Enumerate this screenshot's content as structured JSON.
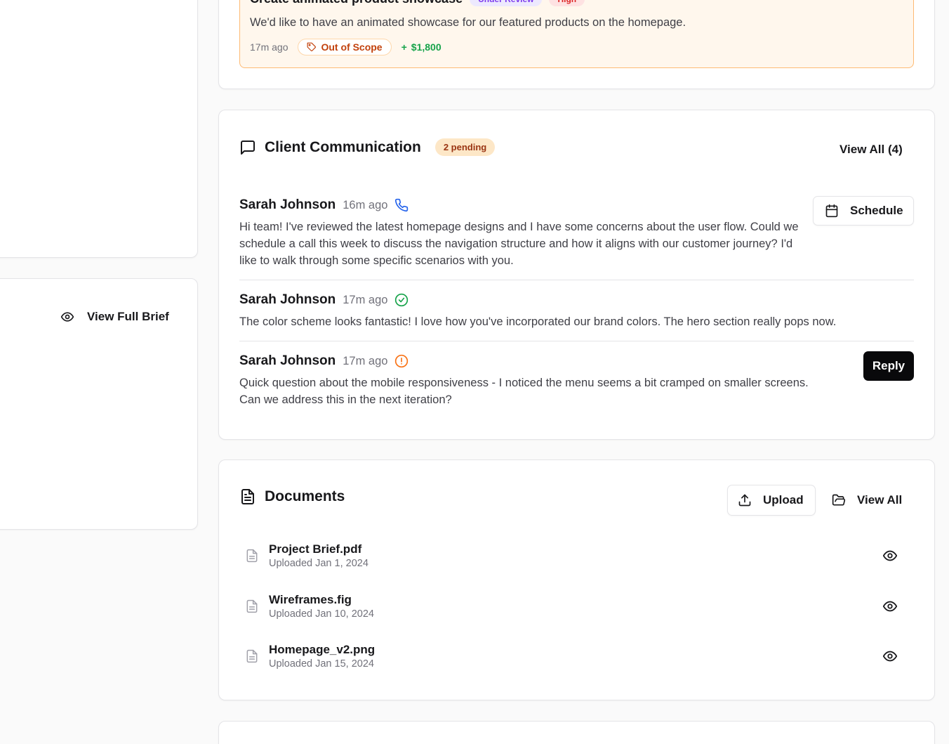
{
  "left": {
    "view_full_brief": "View Full Brief"
  },
  "request": {
    "title": "Create animated product showcase",
    "status_badge": "Under Review",
    "priority_badge": "High",
    "description": "We'd like to have an animated showcase for our featured products on the homepage.",
    "time": "17m ago",
    "scope_label": "Out of Scope",
    "amount": "$1,800"
  },
  "communication": {
    "title": "Client Communication",
    "pending": "2 pending",
    "view_all": "View All (4)",
    "schedule_label": "Schedule",
    "reply_label": "Reply",
    "messages": [
      {
        "author": "Sarah Johnson",
        "time": "16m ago",
        "type_icon": "phone-icon",
        "body": "Hi team! I've reviewed the latest homepage designs and I have some concerns about the user flow. Could we schedule a call this week to discuss the navigation structure and how it aligns with our customer journey? I'd like to walk through some specific scenarios with you."
      },
      {
        "author": "Sarah Johnson",
        "time": "17m ago",
        "type_icon": "check-circle-icon",
        "body": "The color scheme looks fantastic! I love how you've incorporated our brand colors. The hero section really pops now."
      },
      {
        "author": "Sarah Johnson",
        "time": "17m ago",
        "type_icon": "alert-circle-icon",
        "body": "Quick question about the mobile responsiveness - I noticed the menu seems a bit cramped on smaller screens. Can we address this in the next iteration?"
      }
    ]
  },
  "documents": {
    "title": "Documents",
    "upload_label": "Upload",
    "view_all": "View All",
    "files": [
      {
        "name": "Project Brief.pdf",
        "uploaded": "Uploaded Jan 1, 2024"
      },
      {
        "name": "Wireframes.fig",
        "uploaded": "Uploaded Jan 10, 2024"
      },
      {
        "name": "Homepage_v2.png",
        "uploaded": "Uploaded Jan 15, 2024"
      }
    ]
  },
  "colors": {
    "accent_orange": "#f97316",
    "success_green": "#16a34a",
    "info_blue": "#2563eb",
    "primary_dark": "#09090b"
  }
}
